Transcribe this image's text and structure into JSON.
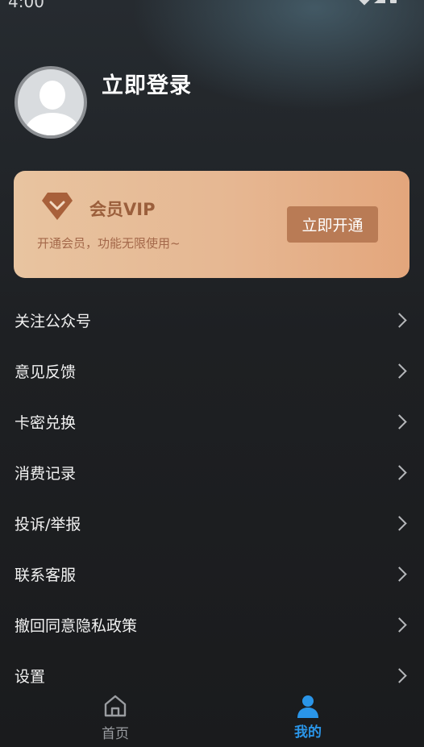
{
  "status_bar": {
    "time": "4:00"
  },
  "profile": {
    "login_title": "立即登录"
  },
  "vip": {
    "title": "会员VIP",
    "subtitle": "开通会员，功能无限使用~",
    "button": "立即开通",
    "colors": {
      "card_start": "#e8c4a0",
      "card_end": "#e3a67c",
      "button": "#b97b55",
      "text": "#9b5f3c"
    }
  },
  "menu": {
    "items": [
      {
        "label": "关注公众号"
      },
      {
        "label": "意见反馈"
      },
      {
        "label": "卡密兑换"
      },
      {
        "label": "消费记录"
      },
      {
        "label": "投诉/举报"
      },
      {
        "label": "联系客服"
      },
      {
        "label": "撤回同意隐私政策"
      },
      {
        "label": "设置"
      }
    ]
  },
  "tabbar": {
    "tabs": [
      {
        "label": "首页",
        "icon": "home-icon",
        "active": false
      },
      {
        "label": "我的",
        "icon": "user-icon",
        "active": true
      }
    ],
    "active_color": "#2a95e8"
  }
}
